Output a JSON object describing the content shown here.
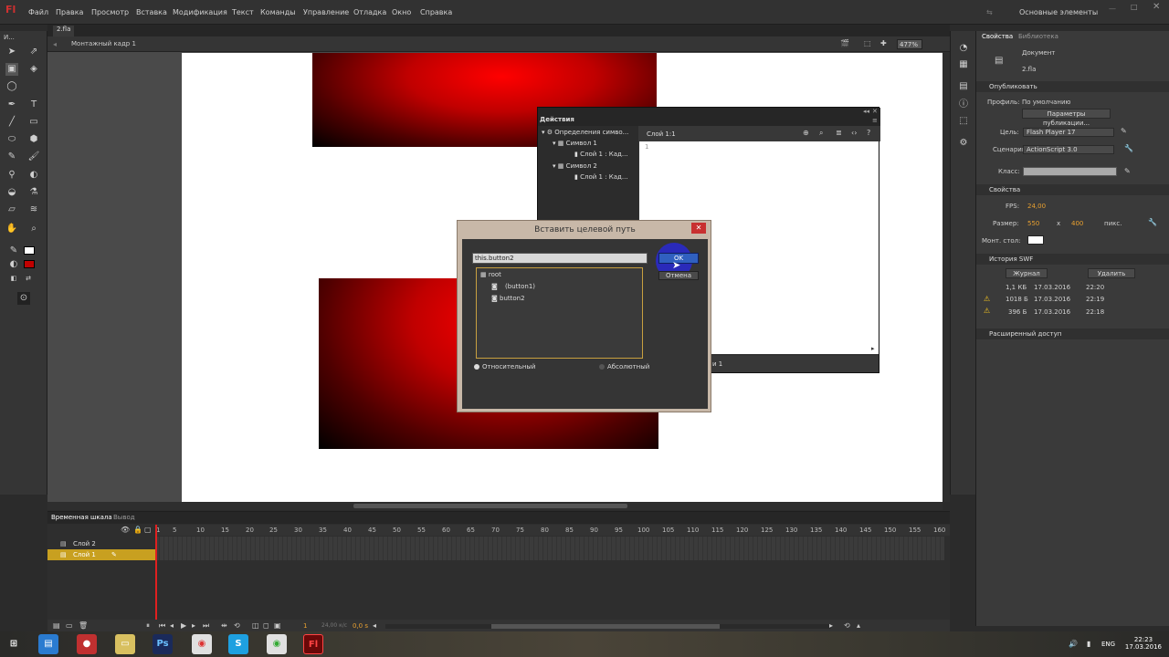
{
  "app": {
    "logo": "Fl",
    "workspace": "Основные элементы"
  },
  "menu": [
    "Файл",
    "Правка",
    "Просмотр",
    "Вставка",
    "Модификация",
    "Текст",
    "Команды",
    "Управление",
    "Отладка",
    "Окно",
    "Справка"
  ],
  "document": {
    "tab": "2.fla",
    "scene": "Монтажный кадр 1",
    "zoom": "477%"
  },
  "toolbar": {
    "top_label": "И..."
  },
  "actions_panel": {
    "tab": "Действия",
    "tree": [
      "Определения симво...",
      "Символ 1",
      "Слой 1 : Кад...",
      "Символ 2",
      "Слой 1 : Кад..."
    ],
    "script_label": "Слой 1:1",
    "line_number": "1",
    "status_text": "и 1"
  },
  "dialog": {
    "title": "Вставить целевой путь",
    "path_value": "this.button2",
    "ok": "OK",
    "cancel": "Отмена",
    "tree": [
      "root",
      "(button1)",
      "button2"
    ],
    "radio_relative": "Относительный",
    "radio_absolute": "Абсолютный"
  },
  "properties": {
    "tabs": [
      "Свойства",
      "Библиотека"
    ],
    "doc_label": "Документ",
    "doc_name": "2.fla",
    "publish_section": "Опубликовать",
    "profile_label": "Профиль:",
    "profile_value": "По умолчанию",
    "publish_settings_btn": "Параметры публикации...",
    "target_label": "Цель:",
    "target_value": "Flash Player 17",
    "script_label": "Сценарий:",
    "script_value": "ActionScript 3.0",
    "class_label": "Класс:",
    "props_section": "Свойства",
    "fps_label": "FPS:",
    "fps_value": "24,00",
    "size_label": "Размер:",
    "width": "550",
    "x": "x",
    "height": "400",
    "unit": "пикс.",
    "stage_label": "Монт. стол:",
    "stage_color": "#ffffff",
    "swf_history_section": "История SWF",
    "log_btn": "Журнал",
    "delete_btn": "Удалить",
    "history": [
      {
        "size": "1,1 КБ",
        "date": "17.03.2016",
        "time": "22:20",
        "warn": false
      },
      {
        "size": "1018 Б",
        "date": "17.03.2016",
        "time": "22:19",
        "warn": true
      },
      {
        "size": "396 Б",
        "date": "17.03.2016",
        "time": "22:18",
        "warn": true
      }
    ],
    "advanced_section": "Расширенный доступ"
  },
  "timeline": {
    "tabs": [
      "Временная шкала",
      "Вывод"
    ],
    "layers": [
      "Слой 2",
      "Слой 1"
    ],
    "ticks": [
      "1",
      "5",
      "10",
      "15",
      "20",
      "25",
      "30",
      "35",
      "40",
      "45",
      "50",
      "55",
      "60",
      "65",
      "70",
      "75",
      "80",
      "85",
      "90",
      "95",
      "100",
      "105",
      "110",
      "115",
      "120",
      "125",
      "130",
      "135",
      "140",
      "145",
      "150",
      "155",
      "160"
    ],
    "frame": "1",
    "fps": "24,00 к/с",
    "time": "0,0 s"
  },
  "taskbar": {
    "lang": "ENG",
    "time": "22:23",
    "date": "17.03.2016"
  }
}
